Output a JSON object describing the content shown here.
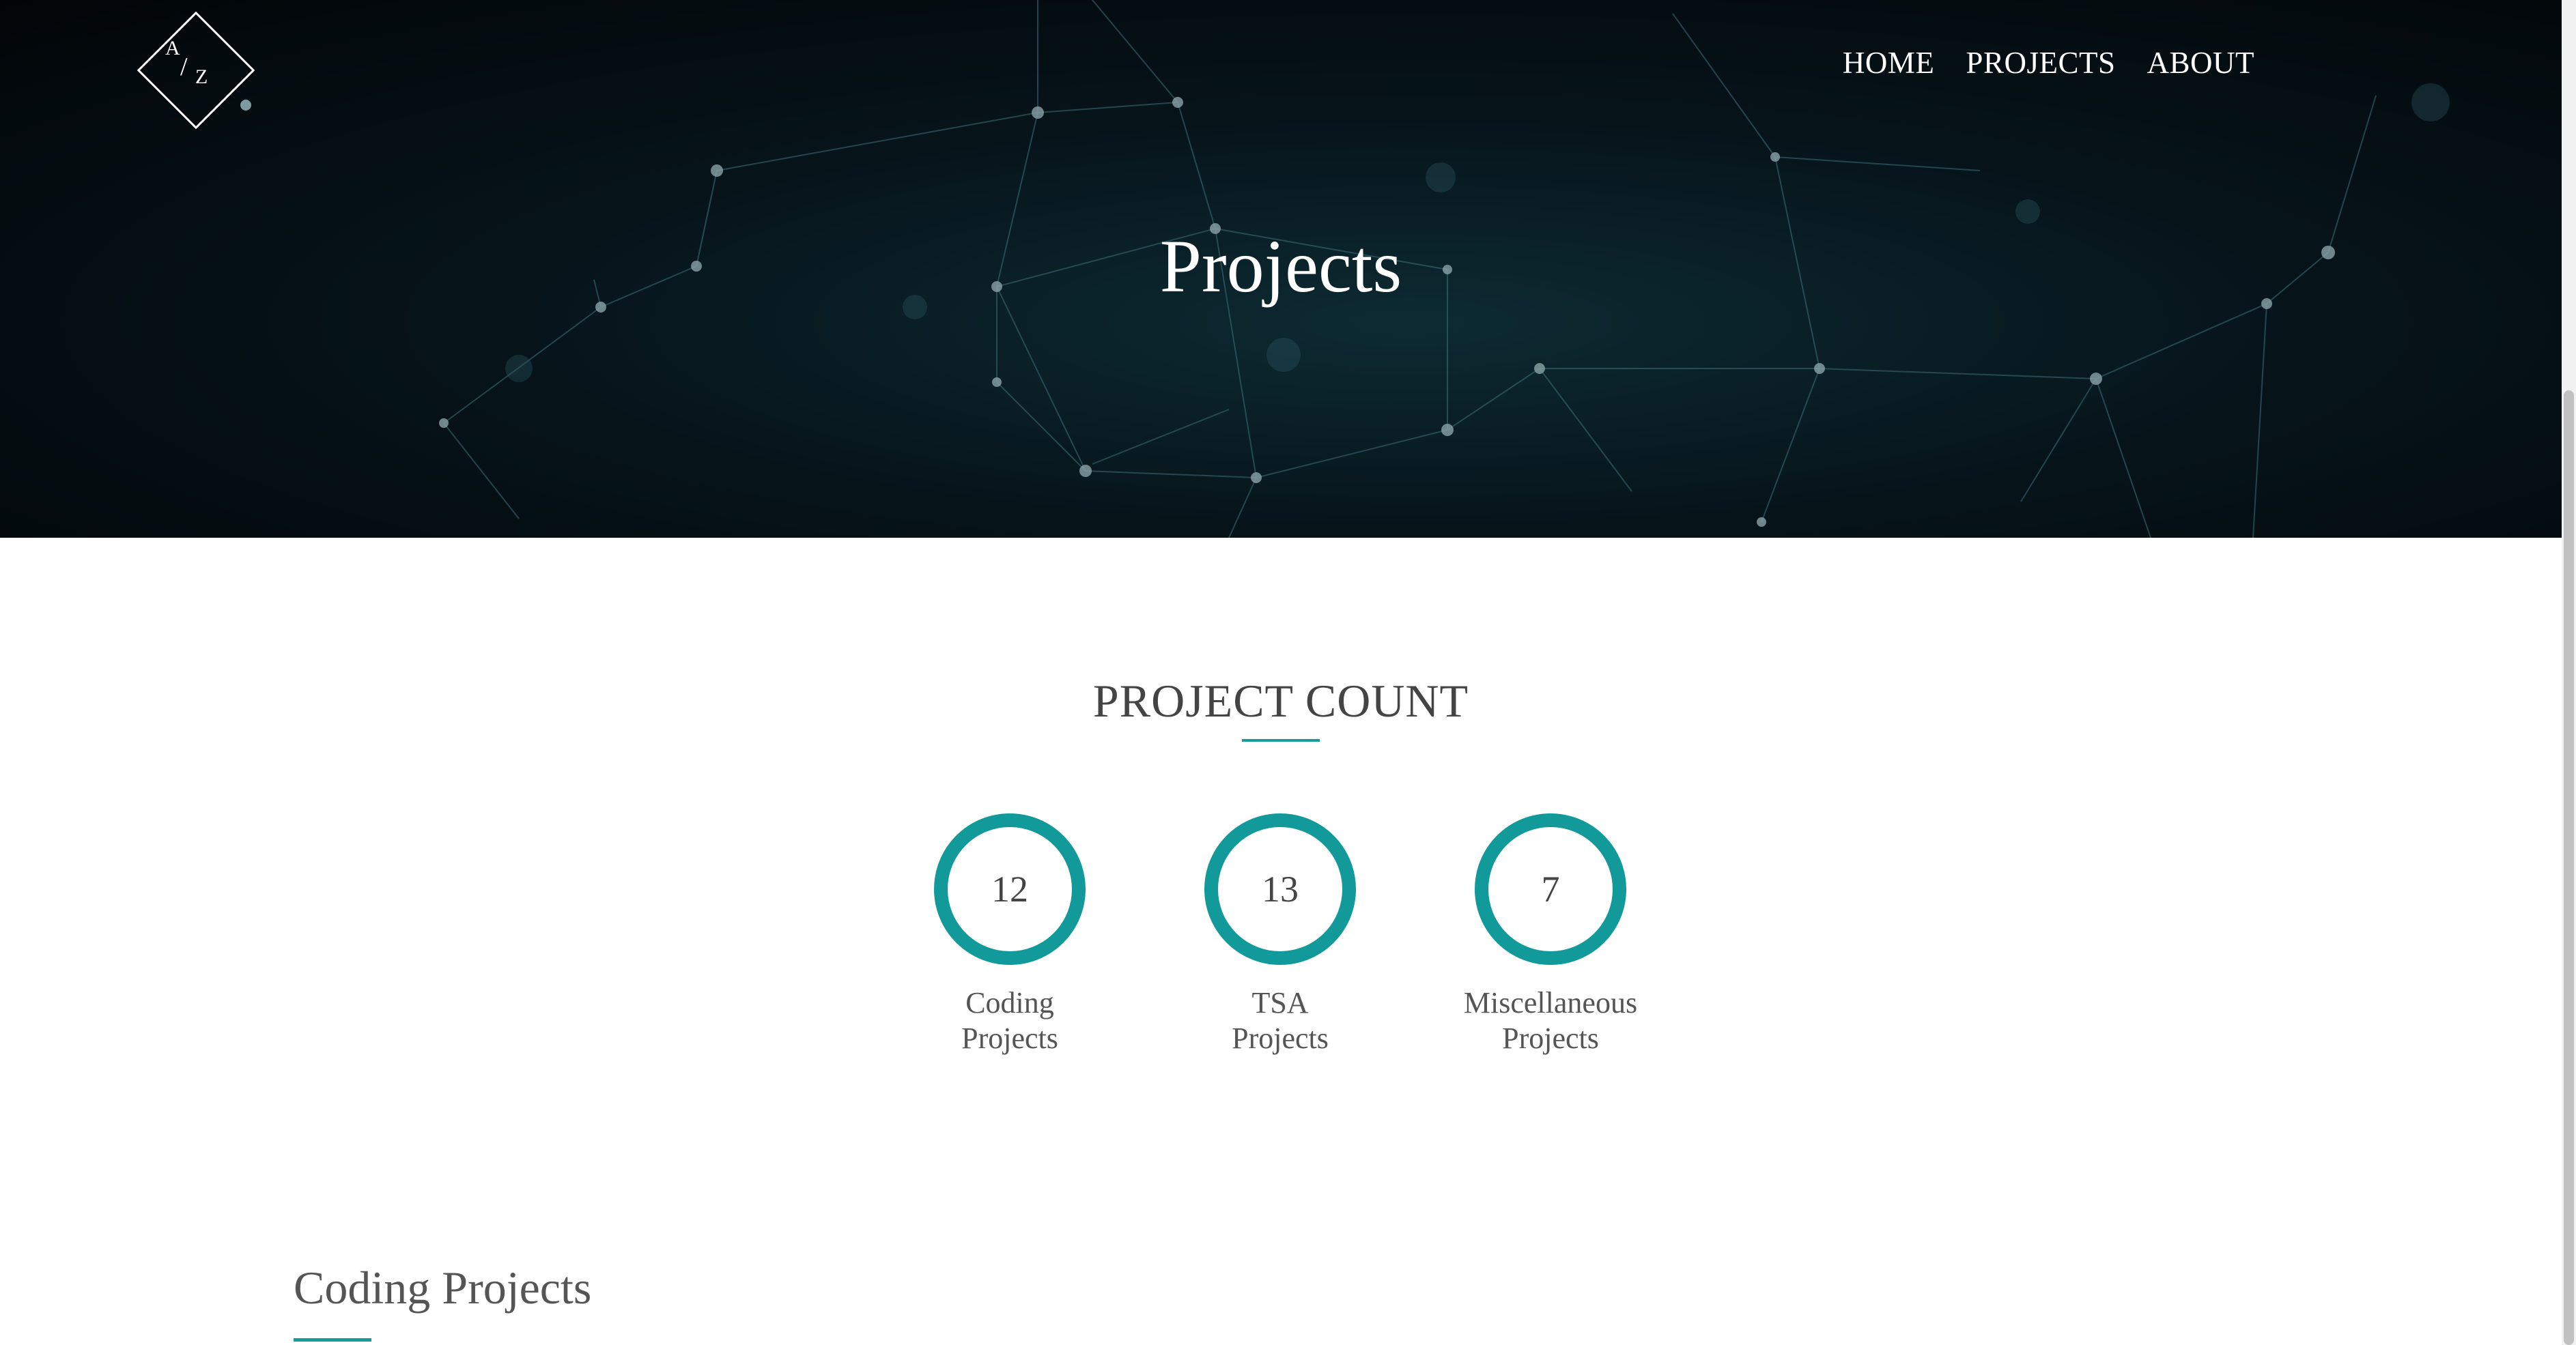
{
  "logo": {
    "top": "A",
    "slash": "/",
    "bottom": "Z"
  },
  "nav": [
    {
      "label": "HOME"
    },
    {
      "label": "PROJECTS"
    },
    {
      "label": "ABOUT"
    }
  ],
  "hero": {
    "title": "Projects"
  },
  "project_count": {
    "title": "PROJECT COUNT",
    "accent_color": "#12999a",
    "counters": [
      {
        "value": "12",
        "label_line1": "Coding",
        "label_line2": "Projects"
      },
      {
        "value": "13",
        "label_line1": "TSA",
        "label_line2": "Projects"
      },
      {
        "value": "7",
        "label_line1": "Miscellaneous",
        "label_line2": "Projects"
      }
    ]
  },
  "coding_section": {
    "title": "Coding Projects"
  }
}
